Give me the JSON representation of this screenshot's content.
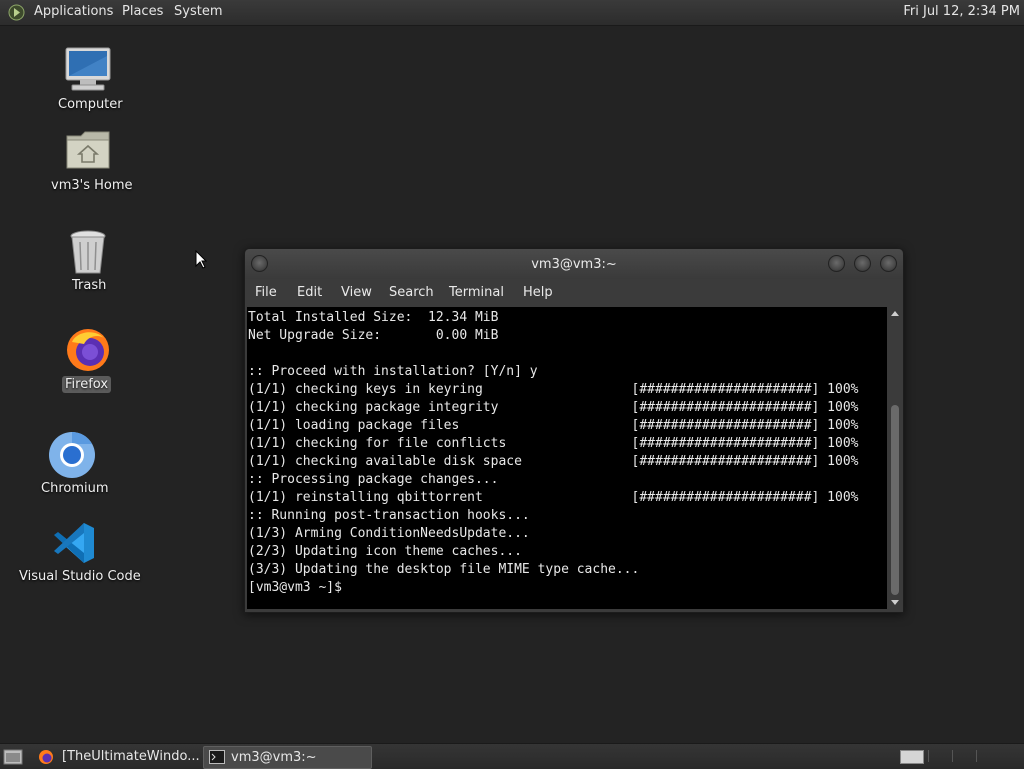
{
  "top_panel": {
    "menus": [
      "Applications",
      "Places",
      "System"
    ],
    "clock": "Fri Jul 12,  2:34 PM",
    "apps_icon": "gnome-foot-icon"
  },
  "desktop": {
    "icons": [
      {
        "label": "Computer",
        "icon": "computer-icon"
      },
      {
        "label": "vm3's Home",
        "icon": "home-folder-icon"
      },
      {
        "label": "Trash",
        "icon": "trash-icon"
      },
      {
        "label": "Firefox",
        "icon": "firefox-icon",
        "selected": true
      },
      {
        "label": "Chromium",
        "icon": "chromium-icon"
      },
      {
        "label": "Visual Studio Code",
        "icon": "vscode-icon"
      }
    ]
  },
  "terminal": {
    "title": "vm3@vm3:~",
    "menu": [
      "File",
      "Edit",
      "View",
      "Search",
      "Terminal",
      "Help"
    ],
    "lines": [
      "Total Installed Size:  12.34 MiB",
      "Net Upgrade Size:       0.00 MiB",
      "",
      ":: Proceed with installation? [Y/n] y",
      "(1/1) checking keys in keyring                   [######################] 100%",
      "(1/1) checking package integrity                 [######################] 100%",
      "(1/1) loading package files                      [######################] 100%",
      "(1/1) checking for file conflicts                [######################] 100%",
      "(1/1) checking available disk space              [######################] 100%",
      ":: Processing package changes...",
      "(1/1) reinstalling qbittorrent                   [######################] 100%",
      ":: Running post-transaction hooks...",
      "(1/3) Arming ConditionNeedsUpdate...",
      "(2/3) Updating icon theme caches...",
      "(3/3) Updating the desktop file MIME type cache...",
      "[vm3@vm3 ~]$"
    ]
  },
  "taskbar": {
    "tasks": [
      {
        "title": "[TheUltimateWindo...",
        "icon": "firefox-icon"
      },
      {
        "title": "vm3@vm3:~",
        "icon": "terminal-icon",
        "active": true
      }
    ]
  },
  "colors": {
    "desktop_bg": "#232323",
    "panel_bg": "#2f2f2f",
    "terminal_bg": "#000000",
    "window_chrome": "#3b3b3b"
  }
}
